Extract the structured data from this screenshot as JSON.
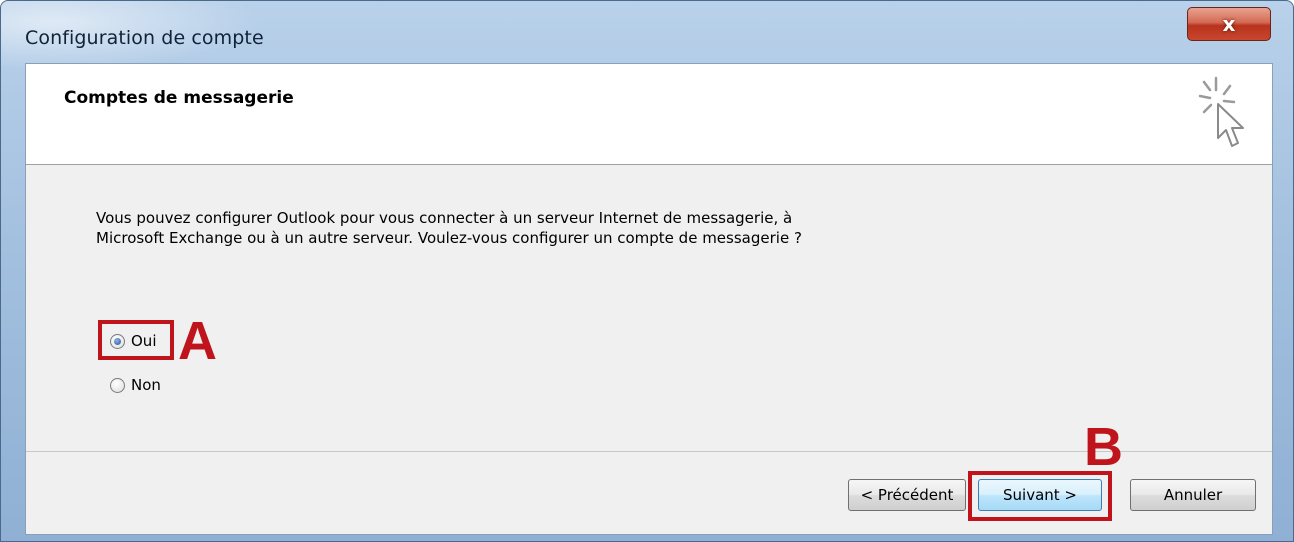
{
  "window": {
    "title": "Configuration de compte",
    "close_glyph": "x"
  },
  "header": {
    "title": "Comptes de messagerie",
    "icon": "wizard-cursor-icon"
  },
  "body": {
    "description": "Vous pouvez configurer Outlook pour vous connecter à un serveur Internet de messagerie, à Microsoft Exchange ou à un autre serveur. Voulez-vous configurer un compte de messagerie ?"
  },
  "options": [
    {
      "label": "Oui",
      "checked": true
    },
    {
      "label": "Non",
      "checked": false
    }
  ],
  "annotations": {
    "a": "A",
    "b": "B",
    "color": "#c0141c"
  },
  "buttons": {
    "previous": "< Précédent",
    "next": "Suivant >",
    "cancel": "Annuler"
  }
}
